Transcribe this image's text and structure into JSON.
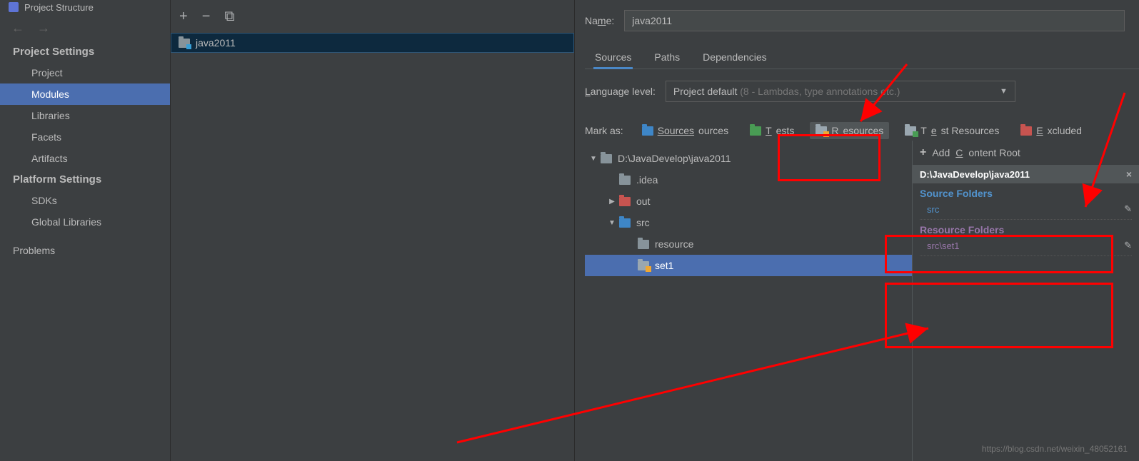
{
  "window": {
    "title": "Project Structure"
  },
  "sidebar": {
    "sections": [
      {
        "header": "Project Settings",
        "items": [
          "Project",
          "Modules",
          "Libraries",
          "Facets",
          "Artifacts"
        ],
        "selected": 1
      },
      {
        "header": "Platform Settings",
        "items": [
          "SDKs",
          "Global Libraries"
        ]
      }
    ],
    "problems": "Problems"
  },
  "modules": {
    "list": [
      "java2011"
    ],
    "selected": 0
  },
  "detail": {
    "name_label": "Name:",
    "name_value": "java2011",
    "tabs": [
      "Sources",
      "Paths",
      "Dependencies"
    ],
    "active_tab": 0,
    "language_label": "Language level:",
    "language_value": "Project default",
    "language_hint": "(8 - Lambdas, type annotations etc.)",
    "mark_label": "Mark as:",
    "mark_buttons": [
      {
        "label": "Sources",
        "color": "sources"
      },
      {
        "label": "Tests",
        "color": "tests"
      },
      {
        "label": "Resources",
        "color": "resources",
        "selected": true
      },
      {
        "label": "Test Resources",
        "color": "testres"
      },
      {
        "label": "Excluded",
        "color": "excluded"
      }
    ],
    "tree": [
      {
        "label": "D:\\JavaDevelop\\java2011",
        "indent": 0,
        "expand": "open",
        "folder": "gray"
      },
      {
        "label": ".idea",
        "indent": 1,
        "expand": "none",
        "folder": "gray"
      },
      {
        "label": "out",
        "indent": 1,
        "expand": "closed",
        "folder": "orange"
      },
      {
        "label": "src",
        "indent": 1,
        "expand": "open",
        "folder": "blue"
      },
      {
        "label": "resource",
        "indent": 2,
        "expand": "none",
        "folder": "gray"
      },
      {
        "label": "set1",
        "indent": 2,
        "expand": "none",
        "folder": "res",
        "selected": true
      }
    ],
    "roots": {
      "add_label": "Add Content Root",
      "path": "D:\\JavaDevelop\\java2011",
      "sections": [
        {
          "title": "Source Folders",
          "class": "source",
          "items": [
            {
              "path": "src",
              "class": "src"
            }
          ]
        },
        {
          "title": "Resource Folders",
          "class": "resource",
          "items": [
            {
              "path": "src\\set1",
              "class": "res"
            }
          ]
        }
      ]
    }
  },
  "watermark": "https://blog.csdn.net/weixin_48052161"
}
